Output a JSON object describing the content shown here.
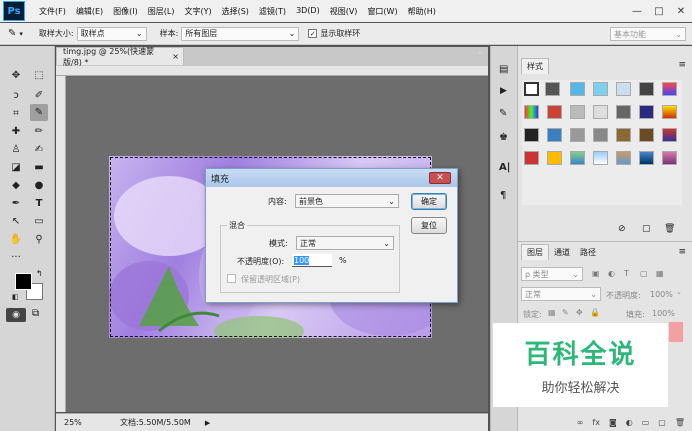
{
  "app": {
    "logo": "Ps"
  },
  "menu": [
    "文件(F)",
    "编辑(E)",
    "图像(I)",
    "图层(L)",
    "文字(Y)",
    "选择(S)",
    "滤镜(T)",
    "3D(D)",
    "视图(V)",
    "窗口(W)",
    "帮助(H)"
  ],
  "window_controls": {
    "minimize": "—",
    "maximize": "□",
    "close": "✕"
  },
  "options": {
    "sample_size_label": "取样大小:",
    "sample_size_value": "取样点",
    "sample_label": "样本:",
    "sample_value": "所有图层",
    "show_ring_label": "显示取样环",
    "workspace": "基本功能"
  },
  "document": {
    "tab_title": "timg.jpg @ 25%(快速蒙版/8) *",
    "tab_close": "×",
    "zoom": "25%",
    "doc_info": "文档:5.50M/5.50M"
  },
  "styles_panel": {
    "tab": "样式"
  },
  "layers_panel": {
    "tabs": [
      "图层",
      "通道",
      "路径"
    ],
    "filter_label": "ρ 类型",
    "blend_mode": "正常",
    "opacity_label": "不透明度:",
    "opacity_value": "100%",
    "lock_label": "锁定:",
    "fill_label": "填充:",
    "fill_value": "100%"
  },
  "fill_dialog": {
    "title": "填充",
    "close": "✕",
    "content_label": "内容:",
    "content_value": "前景色",
    "ok": "确定",
    "reset": "复位",
    "blending_group": "混合",
    "mode_label": "模式:",
    "mode_value": "正常",
    "opacity_label": "不透明度(O):",
    "opacity_value": "100",
    "opacity_unit": "%",
    "preserve_label": "保留透明区域(P)"
  },
  "watermark": {
    "title": "百科全说",
    "subtitle": "助你轻松解决"
  },
  "colors": {
    "accent": "#31a8ff",
    "dialog_close": "#c75050",
    "watermark_green": "#2db87a"
  }
}
